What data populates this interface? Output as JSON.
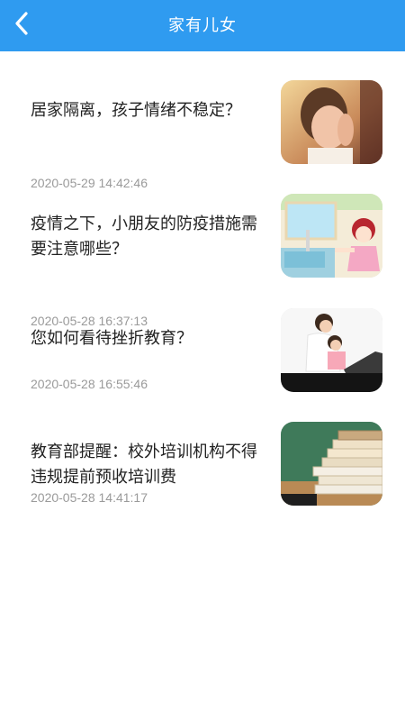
{
  "header": {
    "title": "家有儿女"
  },
  "articles": [
    {
      "title": "居家隔离，孩子情绪不稳定？",
      "date": "2020-05-29 14:42:46",
      "image": "crying-child-photo"
    },
    {
      "title": "疫情之下，小朋友的防疫措施需要注意哪些？",
      "date": "2020-05-28 16:37:13",
      "image": "cartoon-girl-washing-hands"
    },
    {
      "title": "您如何看待挫折教育？",
      "date": "2020-05-28 16:55:46",
      "image": "mother-and-child-at-laptop"
    },
    {
      "title": "教育部提醒：校外培训机构不得违规提前预收培训费",
      "date": "2020-05-28 14:41:17",
      "image": "books-and-chalkboard"
    }
  ]
}
